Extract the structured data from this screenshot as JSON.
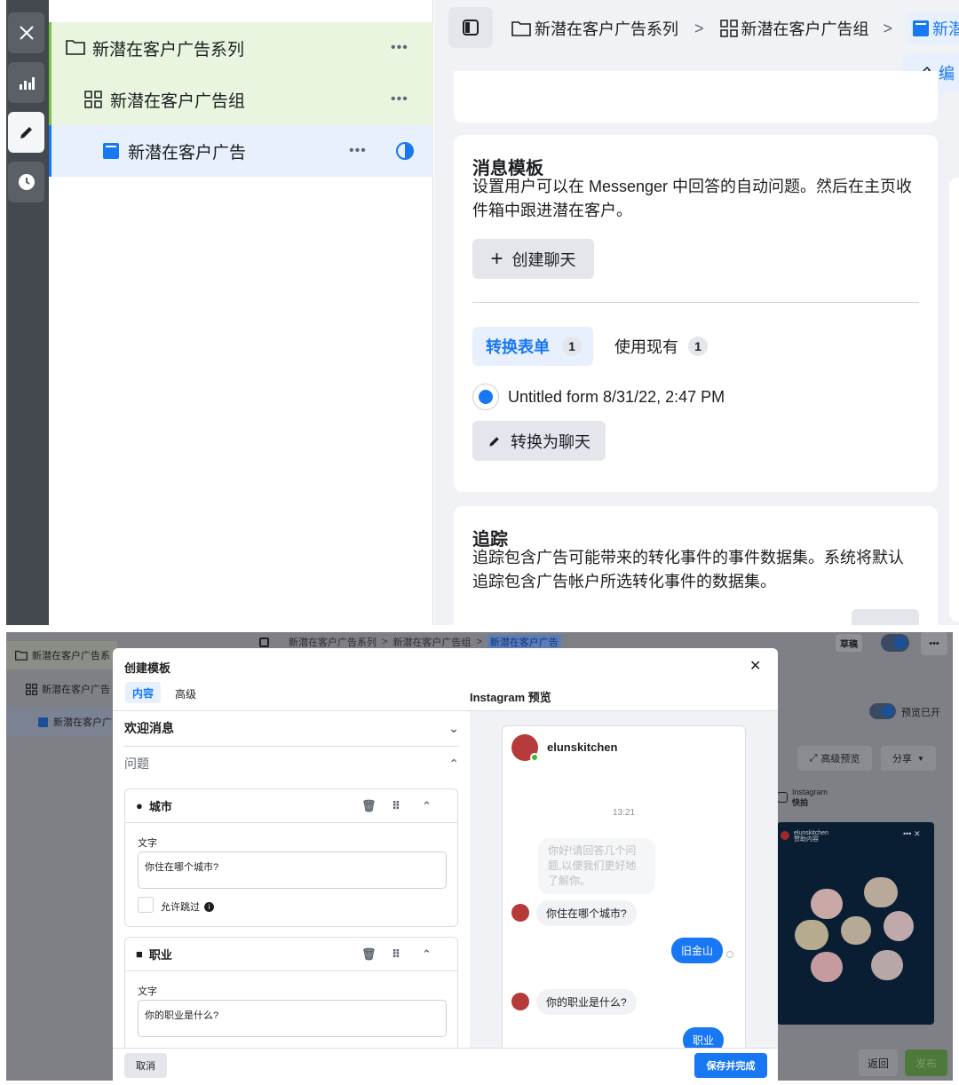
{
  "top": {
    "rail_icons": [
      "close-icon",
      "chart-icon",
      "pencil-icon",
      "clock-icon"
    ],
    "tree": [
      {
        "label": "新潜在客户广告系列",
        "icon": "folder-icon"
      },
      {
        "label": "新潜在客户广告组",
        "icon": "grid-icon"
      },
      {
        "label": "新潜在客户广告",
        "icon": "ad-icon"
      }
    ],
    "dots": "•••",
    "breadcrumb": [
      "新潜在客户广告系列",
      "新潜在客户广告组",
      "新潜"
    ],
    "edit_btn": "编",
    "message_template": {
      "title": "消息模板",
      "desc": "设置用户可以在 Messenger 中回答的自动问题。然后在主页收件箱中跟进潜在客户。",
      "create_btn": "创建聊天",
      "tab_active": "转换表单",
      "tab_active_count": "1",
      "tab_inactive": "使用现有",
      "tab_inactive_count": "1",
      "form_name": "Untitled form 8/31/22, 2:47 PM",
      "convert_btn": "转换为聊天"
    },
    "tracking": {
      "title": "追踪",
      "desc": "追踪包含广告可能带来的转化事件的事件数据集。系统将默认追踪包含广告帐户所选转化事件的数据集。"
    }
  },
  "bottom": {
    "bg_tree": [
      "新潜在客户广告系",
      "新潜在客户广告",
      "新潜在客户广"
    ],
    "bg_breadcrumb": [
      "新潜在客户广告系列",
      "新潜在客户广告组",
      "新潜在客户广告"
    ],
    "bg_draft": "草稿",
    "bg_preview_on": "预览已开",
    "bg_advanced_preview": "高级预览",
    "bg_share": "分享",
    "bg_placement": "Instagram",
    "bg_placement_sub": "快拍",
    "bg_return": "返回",
    "bg_publish": "发布",
    "story_user": "elunskitchen",
    "story_sub": "赞助内容",
    "modal": {
      "title": "创建模板",
      "tab_content": "内容",
      "tab_advanced": "高级",
      "preview_title": "Instagram 预览",
      "welcome": "欢迎消息",
      "questions": "问题",
      "q1_title": "城市",
      "q1_text_label": "文字",
      "q1_value": "你住在哪个城市?",
      "q1_skip": "允许跳过",
      "q2_title": "职业",
      "q2_text_label": "文字",
      "q2_value": "你的职业是什么?",
      "cancel": "取消",
      "save": "保存并完成"
    },
    "preview": {
      "user": "elunskitchen",
      "time": "13:21",
      "intro": "你好!请回答几个问题,以便我们更好地了解你。",
      "q1": "你住在哪个城市?",
      "a1": "旧金山",
      "q2": "你的职业是什么?",
      "a2": "职业"
    }
  },
  "colors": {
    "accent": "#1877f2",
    "tree_green": "#e9f5df",
    "tree_blue": "#e7f0fc",
    "page_bg": "#f0f2f5"
  }
}
